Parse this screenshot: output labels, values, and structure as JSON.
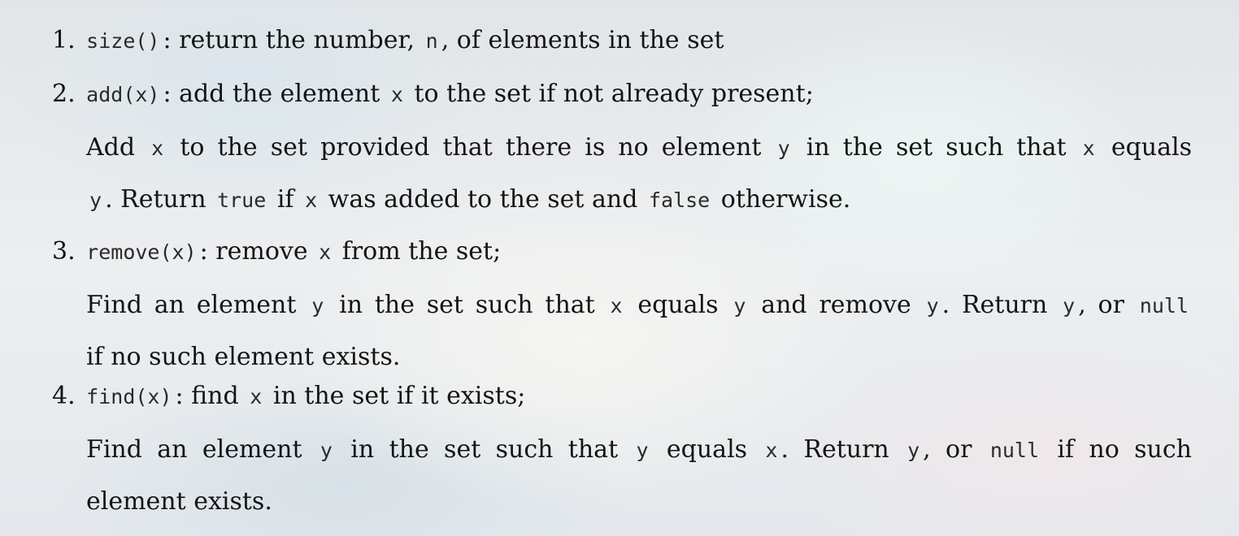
{
  "items": [
    {
      "number": "1.",
      "method": "size()",
      "head": [
        ": return the number, ",
        "n",
        ", of elements in the set"
      ]
    },
    {
      "number": "2.",
      "method": "add(x)",
      "head": [
        ": add the element ",
        "x",
        " to the set if not already present;"
      ],
      "detail1": [
        "Add ",
        "x",
        " to the set provided that there is no element ",
        "y",
        " in the set such that ",
        "x",
        " equals"
      ],
      "detail2": [
        "y",
        ". Return ",
        "true",
        " if ",
        "x",
        " was added to the set and ",
        "false",
        " otherwise."
      ]
    },
    {
      "number": "3.",
      "method": "remove(x)",
      "head": [
        ": remove ",
        "x",
        " from the set;"
      ],
      "detail1": [
        "Find an element ",
        "y",
        " in the set such that ",
        "x",
        " equals ",
        "y",
        " and remove ",
        "y",
        ". Return ",
        "y",
        ", or ",
        "null"
      ],
      "detail2": [
        "if no such element exists."
      ]
    },
    {
      "number": "4.",
      "method": "find(x)",
      "head": [
        ": find ",
        "x",
        " in the set if it exists;"
      ],
      "detail1": [
        "Find an element ",
        "y",
        " in the set such that ",
        "y",
        " equals ",
        "x",
        ". Return ",
        "y",
        ", or ",
        "null",
        " if no such"
      ],
      "detail2": [
        "element exists."
      ]
    }
  ]
}
